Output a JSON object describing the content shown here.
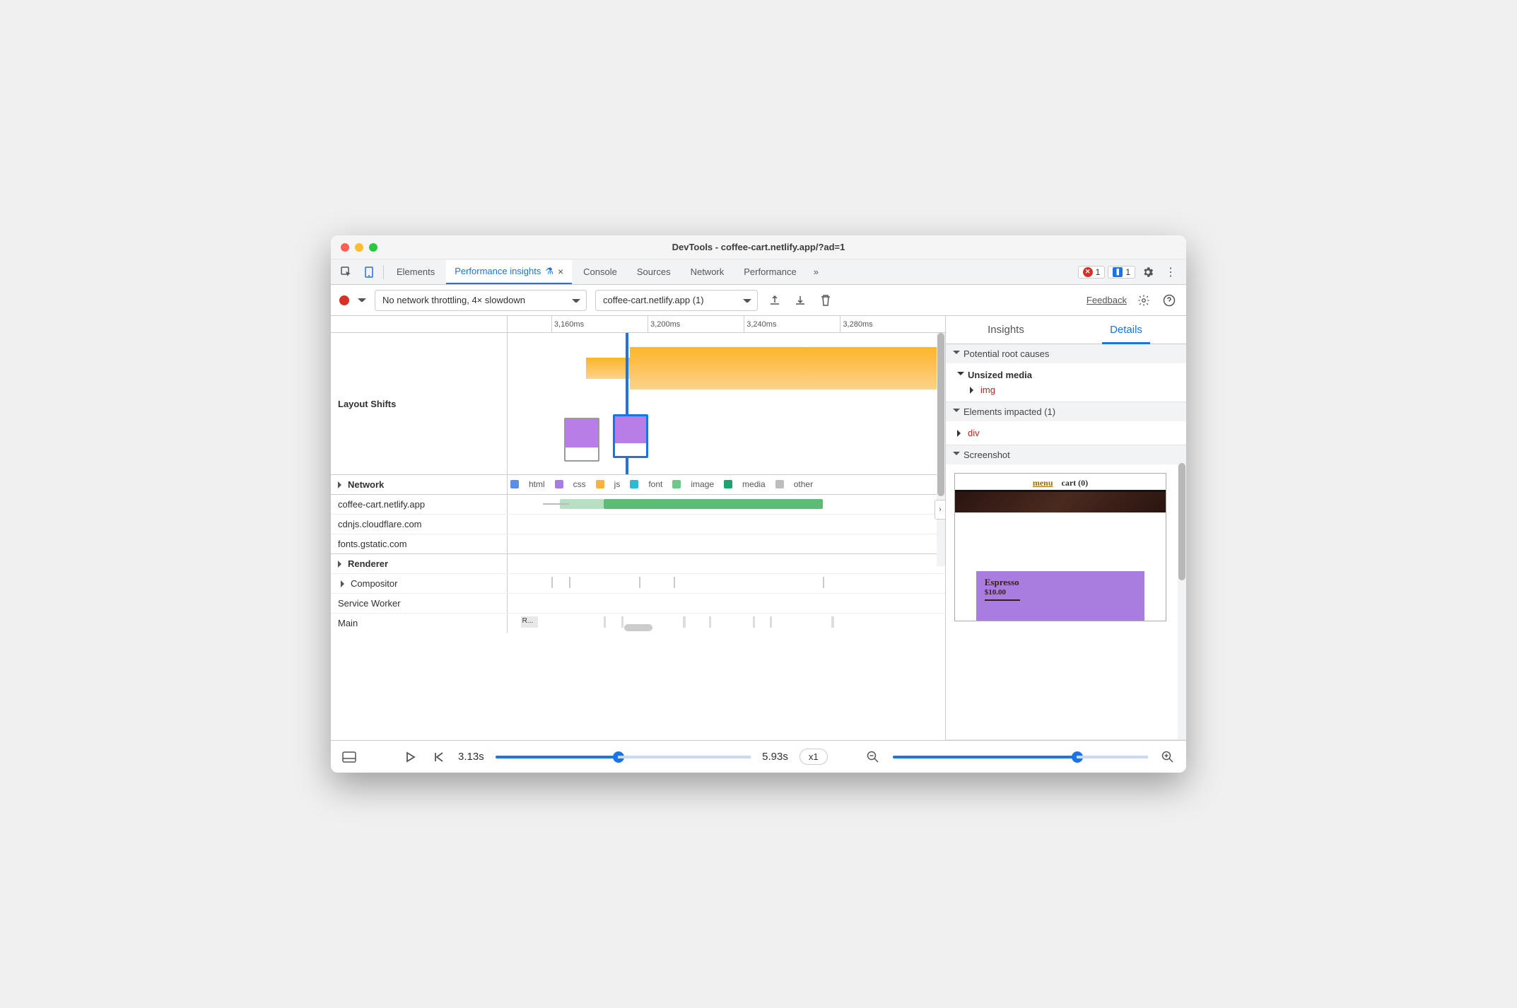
{
  "title": "DevTools - coffee-cart.netlify.app/?ad=1",
  "tabs": [
    "Elements",
    "Performance insights",
    "Console",
    "Sources",
    "Network",
    "Performance"
  ],
  "active_tab": "Performance insights",
  "error_badge": "1",
  "issues_badge": "1",
  "toolbar": {
    "throttle": "No network throttling, 4× slowdown",
    "recording": "coffee-cart.netlify.app (1)",
    "feedback": "Feedback"
  },
  "timeline": {
    "ticks": [
      "3,160ms",
      "3,200ms",
      "3,240ms",
      "3,280ms"
    ],
    "layout_shifts": "Layout Shifts",
    "legend": [
      "html",
      "css",
      "js",
      "font",
      "image",
      "media",
      "other"
    ],
    "legend_colors": [
      "#5b8def",
      "#a87de0",
      "#fab23d",
      "#2bb9d9",
      "#6ec889",
      "#1da36f",
      "#bdbdbd"
    ],
    "sections": {
      "network": "Network",
      "renderer": "Renderer",
      "compositor": "Compositor",
      "service_worker": "Service Worker",
      "main": "Main"
    },
    "hosts": [
      "coffee-cart.netlify.app",
      "cdnjs.cloudflare.com",
      "fonts.gstatic.com"
    ],
    "main_task": "R..."
  },
  "details": {
    "tabs": [
      "Insights",
      "Details"
    ],
    "root_causes": "Potential root causes",
    "unsized_media": "Unsized media",
    "img": "img",
    "elements_impacted": "Elements impacted (1)",
    "div": "div",
    "screenshot": "Screenshot",
    "shot": {
      "menu": "menu",
      "cart": "cart (0)",
      "product": "Espresso",
      "price": "$10.00"
    }
  },
  "footer": {
    "start": "3.13s",
    "end": "5.93s",
    "speed": "x1"
  }
}
